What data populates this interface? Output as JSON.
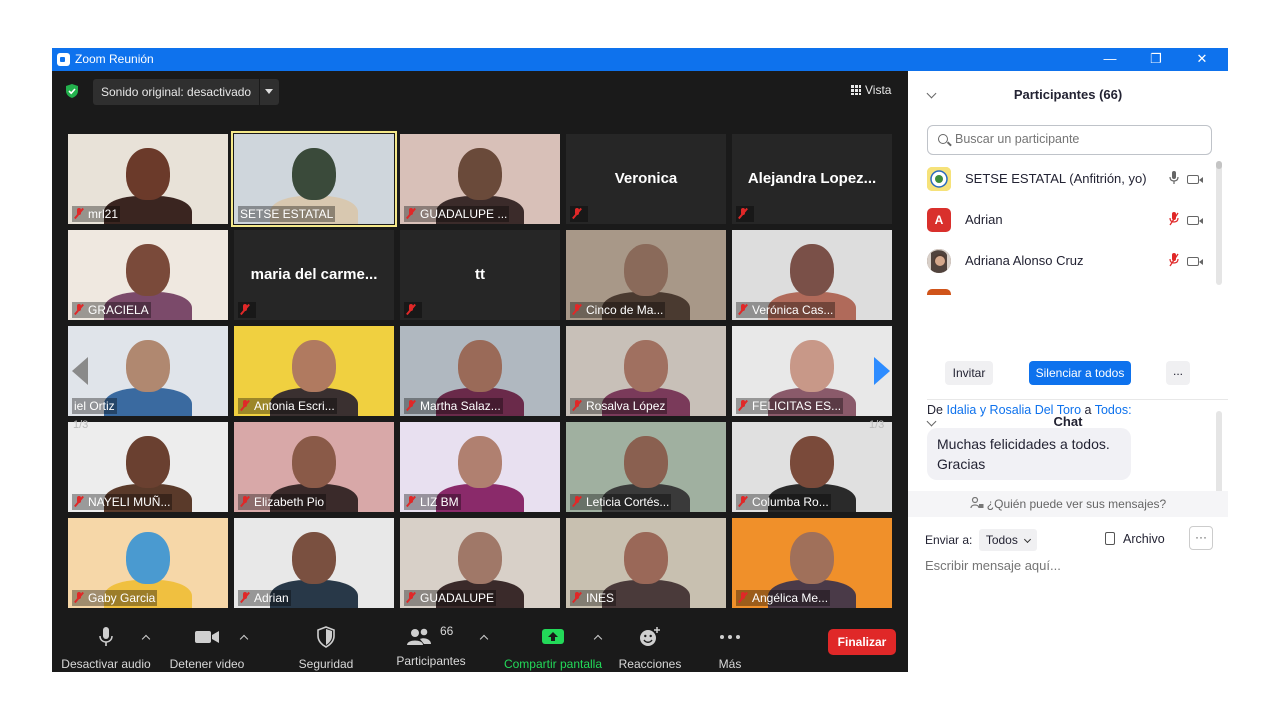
{
  "window": {
    "title": "Zoom Reunión",
    "minimize": "—",
    "restore": "❐",
    "close": "✕"
  },
  "top_bar": {
    "sound_label": "Sonido original: desactivado",
    "view_label": "Vista"
  },
  "pagination": {
    "left": "1/3",
    "right": "1/3"
  },
  "tiles": [
    {
      "name": "mrl21",
      "muted": true,
      "video": true
    },
    {
      "name": "SETSE ESTATAL",
      "muted": false,
      "video": true,
      "active": true
    },
    {
      "name": "GUADALUPE ...",
      "muted": true,
      "video": true
    },
    {
      "name": "Veronica",
      "muted": true,
      "video": false
    },
    {
      "name": "Alejandra  Lopez...",
      "muted": true,
      "video": false
    },
    {
      "name": "GRACIELA",
      "muted": true,
      "video": true
    },
    {
      "name": "maria  del  carme...",
      "muted": true,
      "video": false
    },
    {
      "name": "tt",
      "muted": true,
      "video": false
    },
    {
      "name": "Cinco de Ma...",
      "muted": true,
      "video": true
    },
    {
      "name": "Verónica Cas...",
      "muted": true,
      "video": true
    },
    {
      "name": "iel Ortiz",
      "muted": false,
      "video": true
    },
    {
      "name": "Antonia Escri...",
      "muted": true,
      "video": true
    },
    {
      "name": "Martha Salaz...",
      "muted": true,
      "video": true
    },
    {
      "name": "Rosalva López",
      "muted": true,
      "video": true
    },
    {
      "name": "FELICITAS ES...",
      "muted": true,
      "video": true
    },
    {
      "name": "NAYELI MUÑ...",
      "muted": true,
      "video": true
    },
    {
      "name": "Elizabeth Pio",
      "muted": true,
      "video": true
    },
    {
      "name": "LIZ BM",
      "muted": true,
      "video": true
    },
    {
      "name": "Leticia Cortés...",
      "muted": true,
      "video": true
    },
    {
      "name": "Columba Ro...",
      "muted": true,
      "video": true
    },
    {
      "name": "Gaby Garcia",
      "muted": true,
      "video": true
    },
    {
      "name": "Adrian",
      "muted": true,
      "video": true
    },
    {
      "name": "GUADALUPE",
      "muted": true,
      "video": true
    },
    {
      "name": "INES",
      "muted": true,
      "video": true
    },
    {
      "name": "Angélica Me...",
      "muted": true,
      "video": true
    }
  ],
  "toolbar": {
    "mute_label": "Desactivar audio",
    "video_label": "Detener video",
    "security_label": "Seguridad",
    "participants_label": "Participantes",
    "participants_count": "66",
    "share_label": "Compartir pantalla",
    "reactions_label": "Reacciones",
    "more_label": "Más",
    "end_label": "Finalizar"
  },
  "participants_panel": {
    "title": "Participantes (66)",
    "search_placeholder": "Buscar un participante",
    "rows": [
      {
        "name": "SETSE ESTATAL (Anfitrión, yo)",
        "avatar": "",
        "avatar_color": "#f3d54a"
      },
      {
        "name": "Adrian",
        "avatar": "A",
        "avatar_color": "#d9302c"
      },
      {
        "name": "Adriana Alonso Cruz",
        "avatar": "",
        "avatar_color": "#6b4f45"
      }
    ],
    "invite_label": "Invitar",
    "mute_all_label": "Silenciar a todos",
    "more_label": "..."
  },
  "chat": {
    "title": "Chat",
    "from_prefix": "De",
    "from_sender": "Idalia y Rosalia Del Toro",
    "from_to": "a",
    "from_recipient": "Todos:",
    "message": "Muchas felicidades a todos. Gracias",
    "who_can_see": "¿Quién puede ver sus mensajes?",
    "send_to_label": "Enviar a:",
    "send_to_value": "Todos",
    "file_label": "Archivo",
    "more_label": "···",
    "input_placeholder": "Escribir mensaje aquí..."
  },
  "colors": {
    "titlebar": "#0e72ed",
    "meeting_bg": "#1a1a1a",
    "end_button": "#e02828",
    "share_green": "#23d959",
    "mute_all_blue": "#0e72ed"
  }
}
